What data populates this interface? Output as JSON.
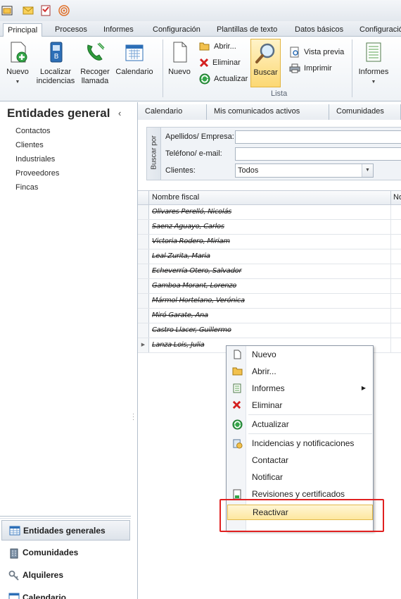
{
  "ribbon_tabs": [
    "Principal",
    "Procesos",
    "Informes",
    "Configuración",
    "Plantillas de texto",
    "Datos básicos",
    "Configuració"
  ],
  "ribbon": {
    "nuevo": "Nuevo",
    "localizar_1": "Localizar",
    "localizar_2": "incidencias",
    "recoger_1": "Recoger",
    "recoger_2": "llamada",
    "calendario": "Calendario",
    "nuevo2": "Nuevo",
    "abrir": "Abrir...",
    "eliminar": "Eliminar",
    "actualizar": "Actualizar",
    "buscar": "Buscar",
    "vista_previa": "Vista previa",
    "imprimir": "Imprimir",
    "informes": "Informes",
    "group_lista": "Lista"
  },
  "nav": {
    "title": "Entidades general",
    "items": [
      "Contactos",
      "Clientes",
      "Industriales",
      "Proveedores",
      "Fincas"
    ],
    "bottom": [
      "Entidades generales",
      "Comunidades",
      "Alquileres",
      "Calendario"
    ]
  },
  "content_tabs": [
    "Calendario",
    "Mis comunicados activos",
    "Comunidades"
  ],
  "search": {
    "panel_label": "Buscar por",
    "label_apellidos": "Apellidos/ Empresa:",
    "label_telefono": "Teléfono/ e-mail:",
    "label_clientes": "Clientes:",
    "clientes_value": "Todos"
  },
  "grid": {
    "col_nombre": "Nombre fiscal",
    "col_next": "No",
    "rows": [
      "Olivares Perelló, Nicolás",
      "Saenz Aguayo, Carlos",
      "Victoria Rodero, Miriam",
      "Leal Zurita, Maria",
      "Echeverría Otero, Salvador",
      "Gamboa Morant, Lorenzo",
      "Mármol Hortelano, Verónica",
      "Miró Garate, Ana",
      "Castro Llacer, Guillermo",
      "Lanza Lois, Julia"
    ]
  },
  "context_menu": {
    "nuevo": "Nuevo",
    "abrir": "Abrir...",
    "informes": "Informes",
    "eliminar": "Eliminar",
    "actualizar": "Actualizar",
    "incidencias": "Incidencias y notificaciones",
    "contactar": "Contactar",
    "notificar": "Notificar",
    "revisiones": "Revisiones y certificados",
    "reactivar": "Reactivar"
  },
  "colors": {
    "highlight": "#fde79f",
    "annotation_red": "#e02020",
    "accent_green": "#2e9b3a",
    "accent_blue": "#2d6fb7"
  }
}
